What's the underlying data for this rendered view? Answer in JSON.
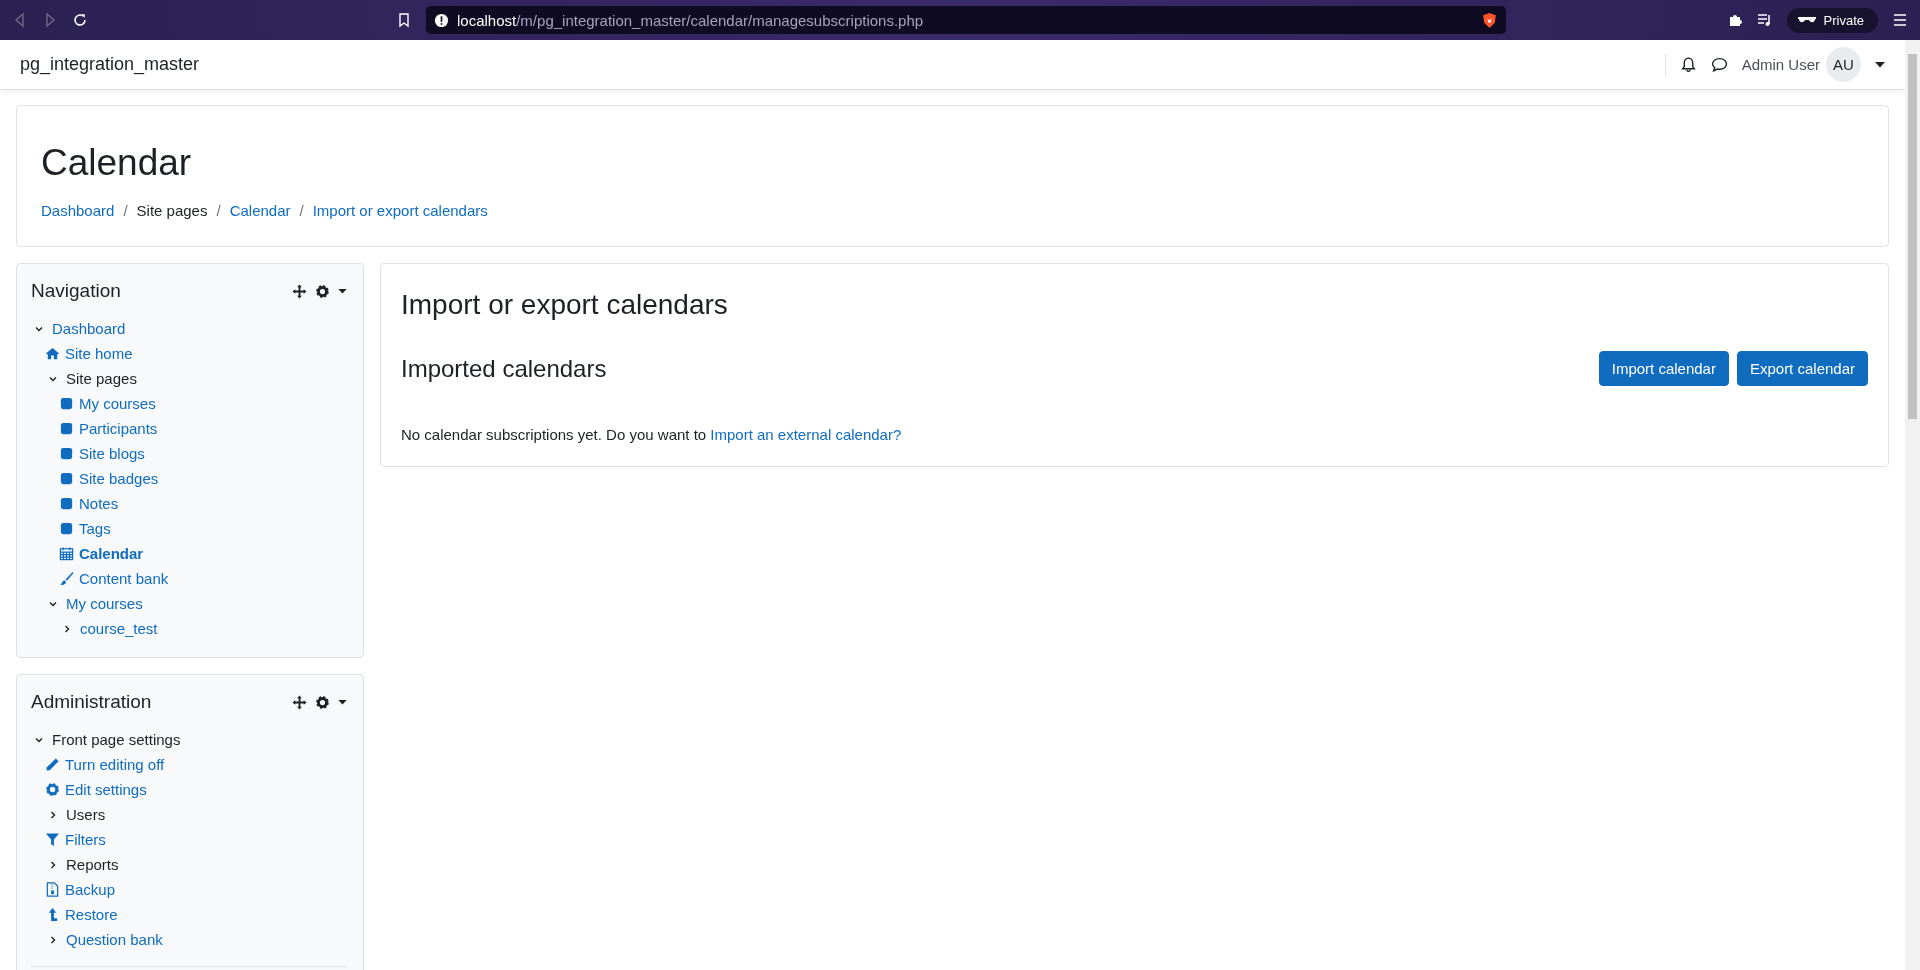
{
  "browser": {
    "url_host": "localhost",
    "url_path": "/m/pg_integration_master/calendar/managesubscriptions.php",
    "private_label": "Private"
  },
  "header": {
    "site_name": "pg_integration_master",
    "user_name": "Admin User",
    "user_initials": "AU"
  },
  "page_header": {
    "title": "Calendar",
    "separator": "/",
    "breadcrumbs": [
      {
        "label": "Dashboard",
        "link": true
      },
      {
        "label": "Site pages",
        "link": false
      },
      {
        "label": "Calendar",
        "link": true
      },
      {
        "label": "Import or export calendars",
        "link": true
      }
    ]
  },
  "blocks": [
    {
      "title": "Navigation",
      "divider": false,
      "items": [
        {
          "kind": "branch",
          "label": "Dashboard",
          "link": true,
          "current": false,
          "expanded": true,
          "children": [
            {
              "kind": "home",
              "label": "Site home",
              "link": true,
              "current": false
            },
            {
              "kind": "branch",
              "label": "Site pages",
              "link": false,
              "current": false,
              "expanded": true,
              "children": [
                {
                  "kind": "page",
                  "label": "My courses",
                  "link": true,
                  "current": false
                },
                {
                  "kind": "page",
                  "label": "Participants",
                  "link": true,
                  "current": false
                },
                {
                  "kind": "page",
                  "label": "Site blogs",
                  "link": true,
                  "current": false
                },
                {
                  "kind": "page",
                  "label": "Site badges",
                  "link": true,
                  "current": false
                },
                {
                  "kind": "page",
                  "label": "Notes",
                  "link": true,
                  "current": false
                },
                {
                  "kind": "page",
                  "label": "Tags",
                  "link": true,
                  "current": false
                },
                {
                  "kind": "calendar",
                  "label": "Calendar",
                  "link": true,
                  "current": true
                },
                {
                  "kind": "brush",
                  "label": "Content bank",
                  "link": true,
                  "current": false
                }
              ]
            },
            {
              "kind": "branch",
              "label": "My courses",
              "link": true,
              "current": false,
              "expanded": true,
              "children": [
                {
                  "kind": "branch",
                  "label": "course_test",
                  "link": true,
                  "current": false,
                  "expanded": false
                }
              ]
            }
          ]
        }
      ]
    },
    {
      "title": "Administration",
      "divider": true,
      "items": [
        {
          "kind": "branch",
          "label": "Front page settings",
          "link": false,
          "current": false,
          "expanded": true,
          "children": [
            {
              "kind": "pencil",
              "label": "Turn editing off",
              "link": true,
              "current": false
            },
            {
              "kind": "gear",
              "label": "Edit settings",
              "link": true,
              "current": false
            },
            {
              "kind": "branch",
              "label": "Users",
              "link": false,
              "current": false,
              "expanded": false
            },
            {
              "kind": "filter",
              "label": "Filters",
              "link": true,
              "current": false
            },
            {
              "kind": "branch",
              "label": "Reports",
              "link": false,
              "current": false,
              "expanded": false
            },
            {
              "kind": "backup",
              "label": "Backup",
              "link": true,
              "current": false
            },
            {
              "kind": "restore",
              "label": "Restore",
              "link": true,
              "current": false
            },
            {
              "kind": "branch",
              "label": "Question bank",
              "link": true,
              "current": false,
              "expanded": false
            }
          ]
        }
      ]
    }
  ],
  "main": {
    "title": "Import or export calendars",
    "section_title": "Imported calendars",
    "buttons": [
      "Import calendar",
      "Export calendar"
    ],
    "message": "No calendar subscriptions yet. Do you want to",
    "message_link": "Import an external calendar?"
  }
}
